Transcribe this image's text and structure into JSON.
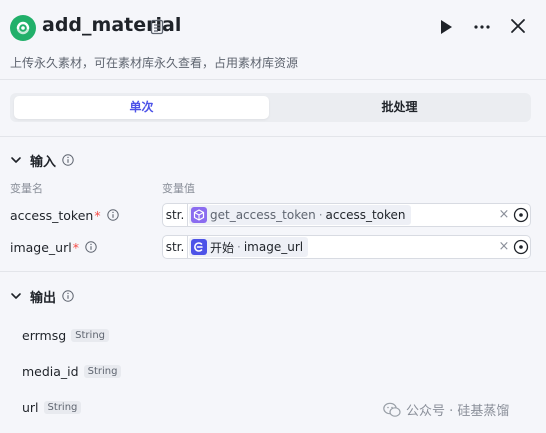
{
  "header": {
    "title": "add_material",
    "description": "上传永久素材，可在素材库永久查看，占用素材库资源"
  },
  "tabs": [
    {
      "label": "单次",
      "active": true
    },
    {
      "label": "批处理",
      "active": false
    }
  ],
  "input_section": {
    "title": "输入",
    "col_name": "变量名",
    "col_value": "变量值",
    "rows": [
      {
        "name": "access_token",
        "required_mark": "*",
        "type_box": "str.",
        "source": "get_access_token",
        "separator": "·",
        "variable": "access_token"
      },
      {
        "name": "image_url",
        "required_mark": "*",
        "type_box": "str.",
        "source": "开始",
        "separator": "·",
        "variable": "image_url"
      }
    ]
  },
  "output_section": {
    "title": "输出",
    "rows": [
      {
        "name": "errmsg",
        "type": "String"
      },
      {
        "name": "media_id",
        "type": "String"
      },
      {
        "name": "url",
        "type": "String"
      }
    ]
  },
  "watermark": {
    "text": "公众号 · 硅基蒸馏"
  },
  "colors": {
    "accent": "#4d53e8",
    "required": "#f54a45",
    "logo_green": "#21b06a",
    "chip_purple": "#8b6cf0",
    "chip_blue": "#4d53e8"
  },
  "icons": [
    "logo-icon",
    "document-icon",
    "play-icon",
    "more-icon",
    "close-icon",
    "chevron-down-icon",
    "info-icon",
    "plugin-node-icon",
    "start-node-icon",
    "clear-icon",
    "variable-target-icon",
    "wechat-icon"
  ]
}
